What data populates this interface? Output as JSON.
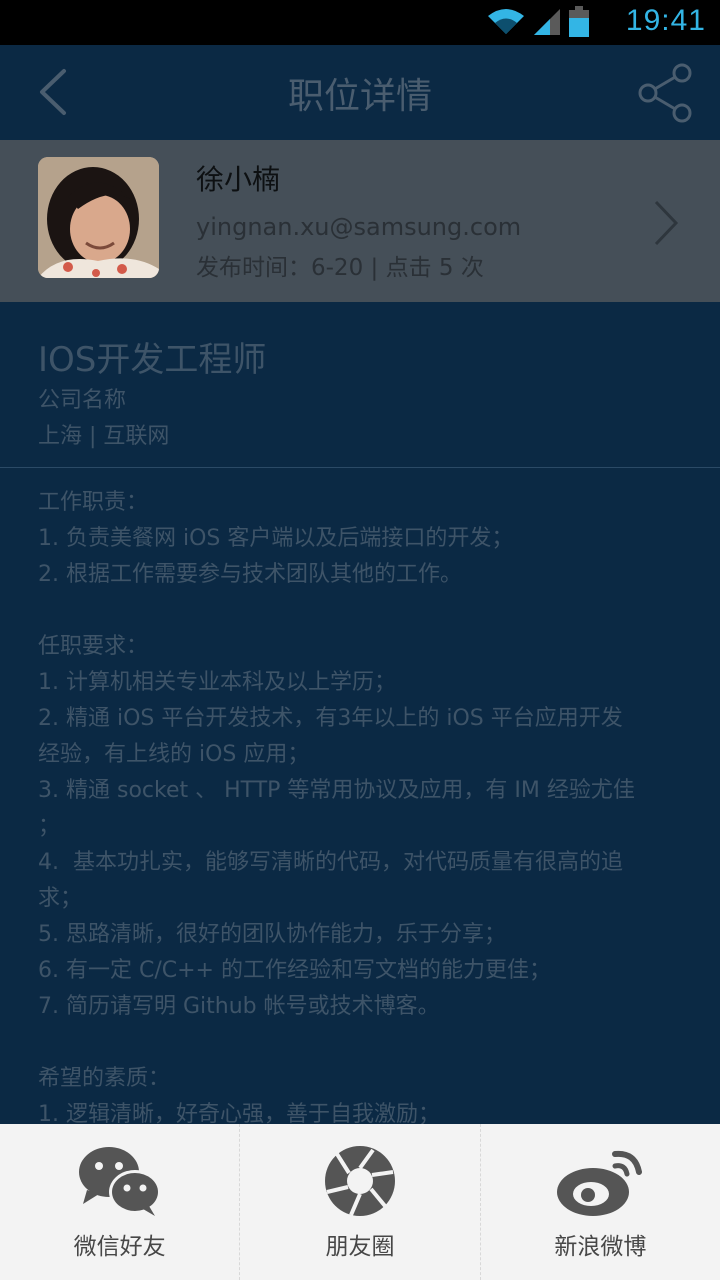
{
  "status": {
    "time": "19:41"
  },
  "appbar": {
    "title": "职位详情"
  },
  "profile": {
    "name": "徐小楠",
    "email": "yingnan.xu@samsung.com",
    "meta": "发布时间：6-20  |  点击 5 次"
  },
  "job": {
    "title": "IOS开发工程师",
    "company": "公司名称",
    "location": "上海 | 互联网"
  },
  "description": {
    "lines": [
      "工作职责：",
      "1. 负责美餐网 iOS 客户端以及后端接口的开发；",
      "2. 根据工作需要参与技术团队其他的工作。",
      "",
      "任职要求：",
      "1. 计算机相关专业本科及以上学历；",
      "2. 精通 iOS 平台开发技术，有3年以上的 iOS 平台应用开发",
      "经验，有上线的 iOS 应用；",
      "3. 精通 socket 、 HTTP 等常用协议及应用，有 IM 经验尤佳",
      "；",
      "4.  基本功扎实，能够写清晰的代码，对代码质量有很高的追",
      "求；",
      "5. 思路清晰，很好的团队协作能力，乐于分享；",
      "6. 有一定 C/C++ 的工作经验和写文档的能力更佳；",
      "7. 简历请写明 Github 帐号或技术博客。",
      "",
      "希望的素质：",
      "1. 逻辑清晰，好奇心强，善于自我激励；"
    ]
  },
  "share": {
    "items": [
      {
        "label": "微信好友",
        "icon": "wechat-icon"
      },
      {
        "label": "朋友圈",
        "icon": "moments-icon"
      },
      {
        "label": "新浪微博",
        "icon": "weibo-icon"
      }
    ]
  },
  "colors": {
    "background": "#0b2944",
    "status_time": "#33b5e5",
    "sheet_bg": "#f3f3f3"
  }
}
